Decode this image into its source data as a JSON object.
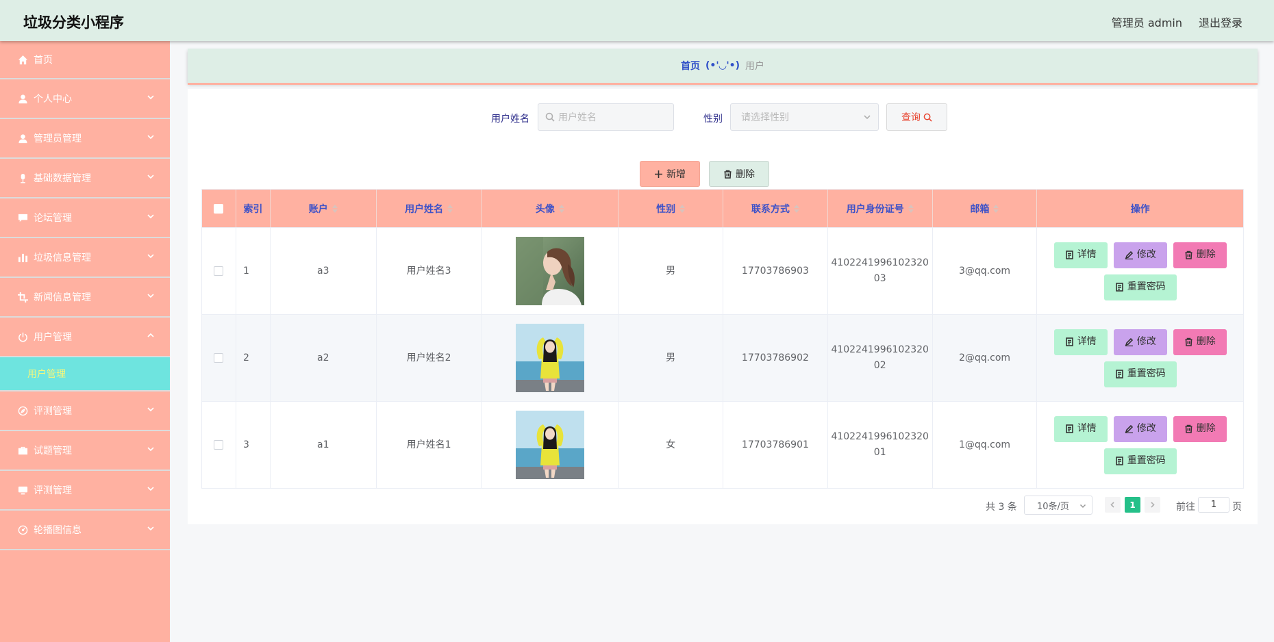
{
  "header": {
    "title": "垃圾分类小程序",
    "admin": "管理员 admin",
    "logout": "退出登录"
  },
  "sidebar": {
    "items": [
      {
        "label": "首页",
        "icon": "home-icon"
      },
      {
        "label": "个人中心",
        "icon": "user-icon"
      },
      {
        "label": "管理员管理",
        "icon": "user-icon"
      },
      {
        "label": "基础数据管理",
        "icon": "microphone-icon"
      },
      {
        "label": "论坛管理",
        "icon": "chat-icon"
      },
      {
        "label": "垃圾信息管理",
        "icon": "bar-chart-icon"
      },
      {
        "label": "新闻信息管理",
        "icon": "crop-icon"
      },
      {
        "label": "用户管理",
        "icon": "power-icon",
        "expanded": true
      },
      {
        "label": "评测管理",
        "icon": "compass-icon"
      },
      {
        "label": "试题管理",
        "icon": "briefcase-icon"
      },
      {
        "label": "评测管理",
        "icon": "monitor-icon"
      },
      {
        "label": "轮播图信息",
        "icon": "gauge-icon"
      }
    ],
    "active_sub": "用户管理"
  },
  "breadcrumb": {
    "home": "首页",
    "sep": "(•'◡'•)",
    "current": "用户"
  },
  "search": {
    "name_label": "用户姓名",
    "name_placeholder": "用户姓名",
    "gender_label": "性别",
    "gender_placeholder": "请选择性别",
    "query_label": "查询"
  },
  "actions": {
    "add_label": "新增",
    "delete_label": "删除"
  },
  "table": {
    "headers": {
      "index": "索引",
      "account": "账户",
      "name": "用户姓名",
      "avatar": "头像",
      "gender": "性别",
      "phone": "联系方式",
      "idcard": "用户身份证号",
      "email": "邮箱",
      "ops": "操作"
    },
    "rows": [
      {
        "index": "1",
        "account": "a3",
        "name": "用户姓名3",
        "gender": "男",
        "phone": "17703786903",
        "idcard_1": "4102241996102320",
        "idcard_2": "03",
        "email": "3@qq.com",
        "avatar": "side-profile-photo"
      },
      {
        "index": "2",
        "account": "a2",
        "name": "用户姓名2",
        "gender": "男",
        "phone": "17703786902",
        "idcard_1": "4102241996102320",
        "idcard_2": "02",
        "email": "2@qq.com",
        "avatar": "yellow-sweater-photo"
      },
      {
        "index": "3",
        "account": "a1",
        "name": "用户姓名1",
        "gender": "女",
        "phone": "17703786901",
        "idcard_1": "4102241996102320",
        "idcard_2": "01",
        "email": "1@qq.com",
        "avatar": "yellow-sweater-photo"
      }
    ],
    "ops": {
      "detail": "详情",
      "edit": "修改",
      "delete": "删除",
      "reset": "重置密码"
    }
  },
  "pagination": {
    "total": "共 3 条",
    "page_size": "10条/页",
    "current": "1",
    "goto_prefix": "前往",
    "goto_value": "1",
    "goto_suffix": "页"
  },
  "colors": {
    "sidebar": "#ffb1a1",
    "header": "#deeee6",
    "active_sub": "#6ee4df",
    "accent_text": "#3e52c8",
    "pager_active": "#25c089"
  }
}
